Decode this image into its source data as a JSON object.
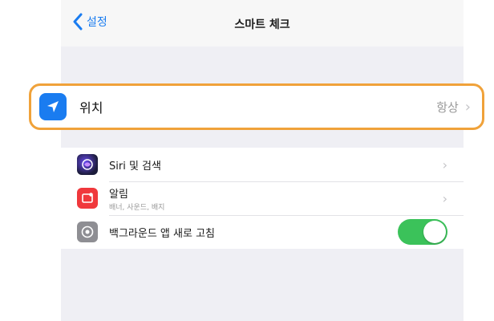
{
  "nav": {
    "back_label": "설정",
    "title": "스마트 체크"
  },
  "location_row": {
    "label": "위치",
    "value": "항상",
    "accent_color": "#1a7cf0",
    "highlight_color": "#f0a23a"
  },
  "rows": [
    {
      "label": "Siri 및 검색",
      "icon": "siri-icon"
    },
    {
      "label": "알림",
      "sublabel": "배너, 사운드, 배지",
      "icon": "notification-icon"
    },
    {
      "label": "백그라운드 앱 새로 고침",
      "icon": "gear-icon",
      "toggle_on": true
    }
  ],
  "toggle_color": "#3bc25a"
}
